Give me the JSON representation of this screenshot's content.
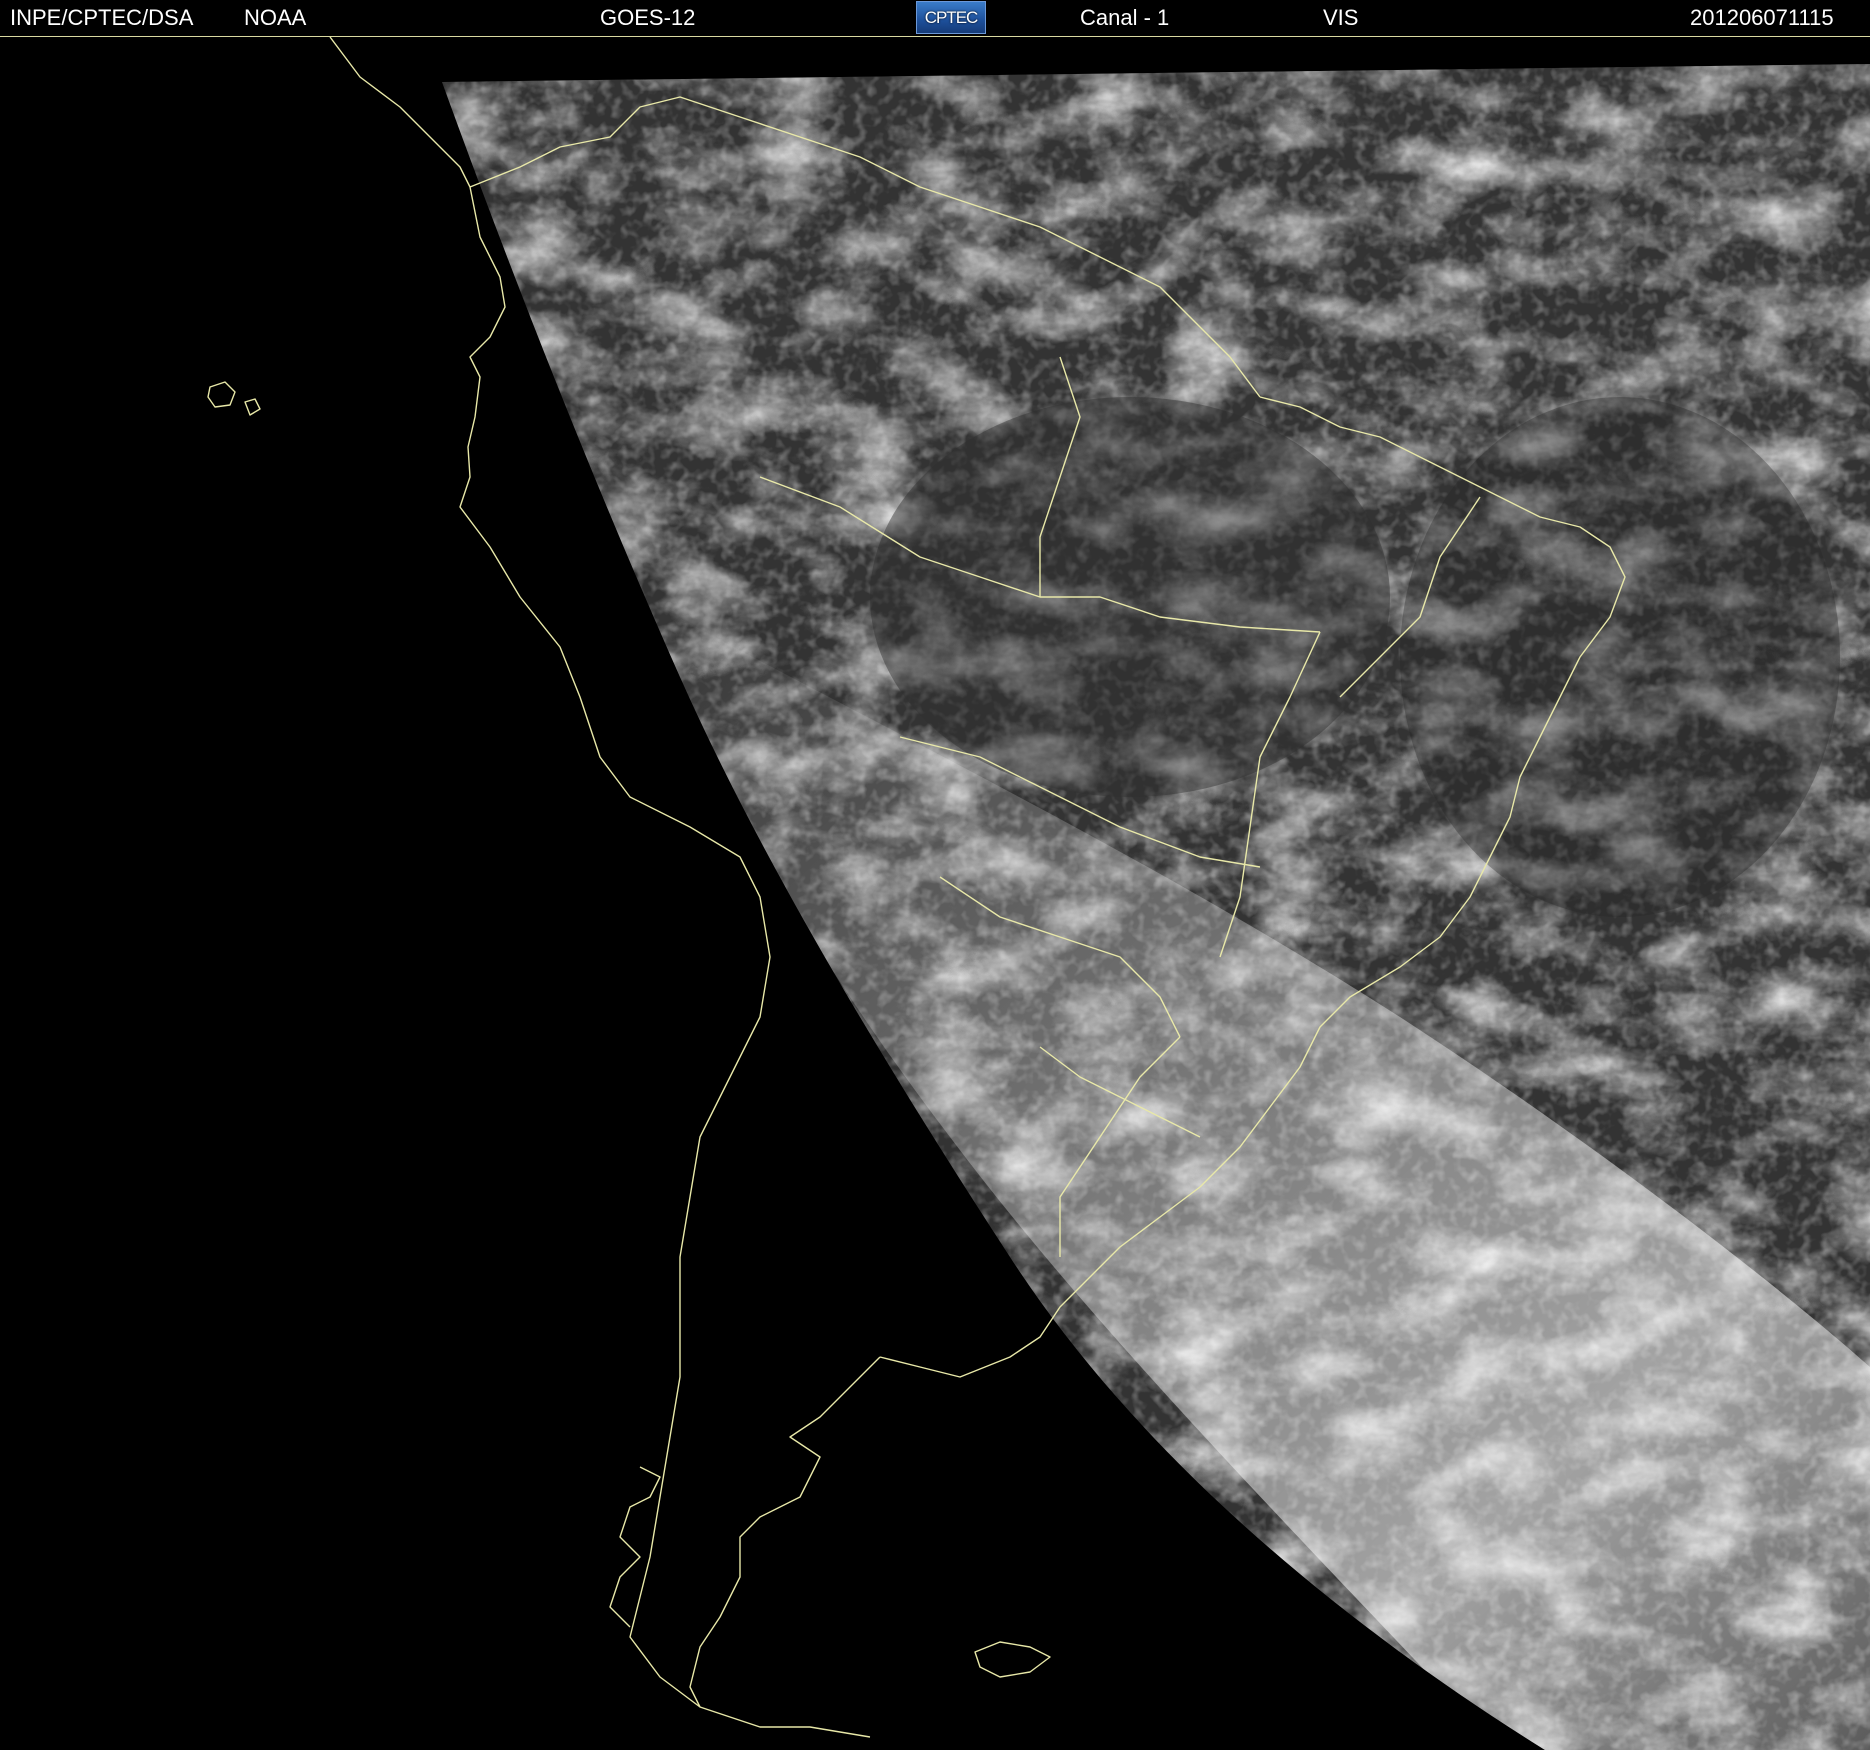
{
  "header": {
    "institution": "INPE/CPTEC/DSA",
    "agency": "NOAA",
    "satellite": "GOES-12",
    "logo_text": "CPTEC",
    "channel": "Canal - 1",
    "band": "VIS",
    "timestamp": "201206071115"
  },
  "colors": {
    "background": "#000000",
    "header_text": "#ffffff",
    "coastline": "#e8e8a8",
    "logo": "#2a63b0"
  },
  "image": {
    "type": "satellite-visible",
    "region": "South America",
    "icon": "satellite-image"
  }
}
